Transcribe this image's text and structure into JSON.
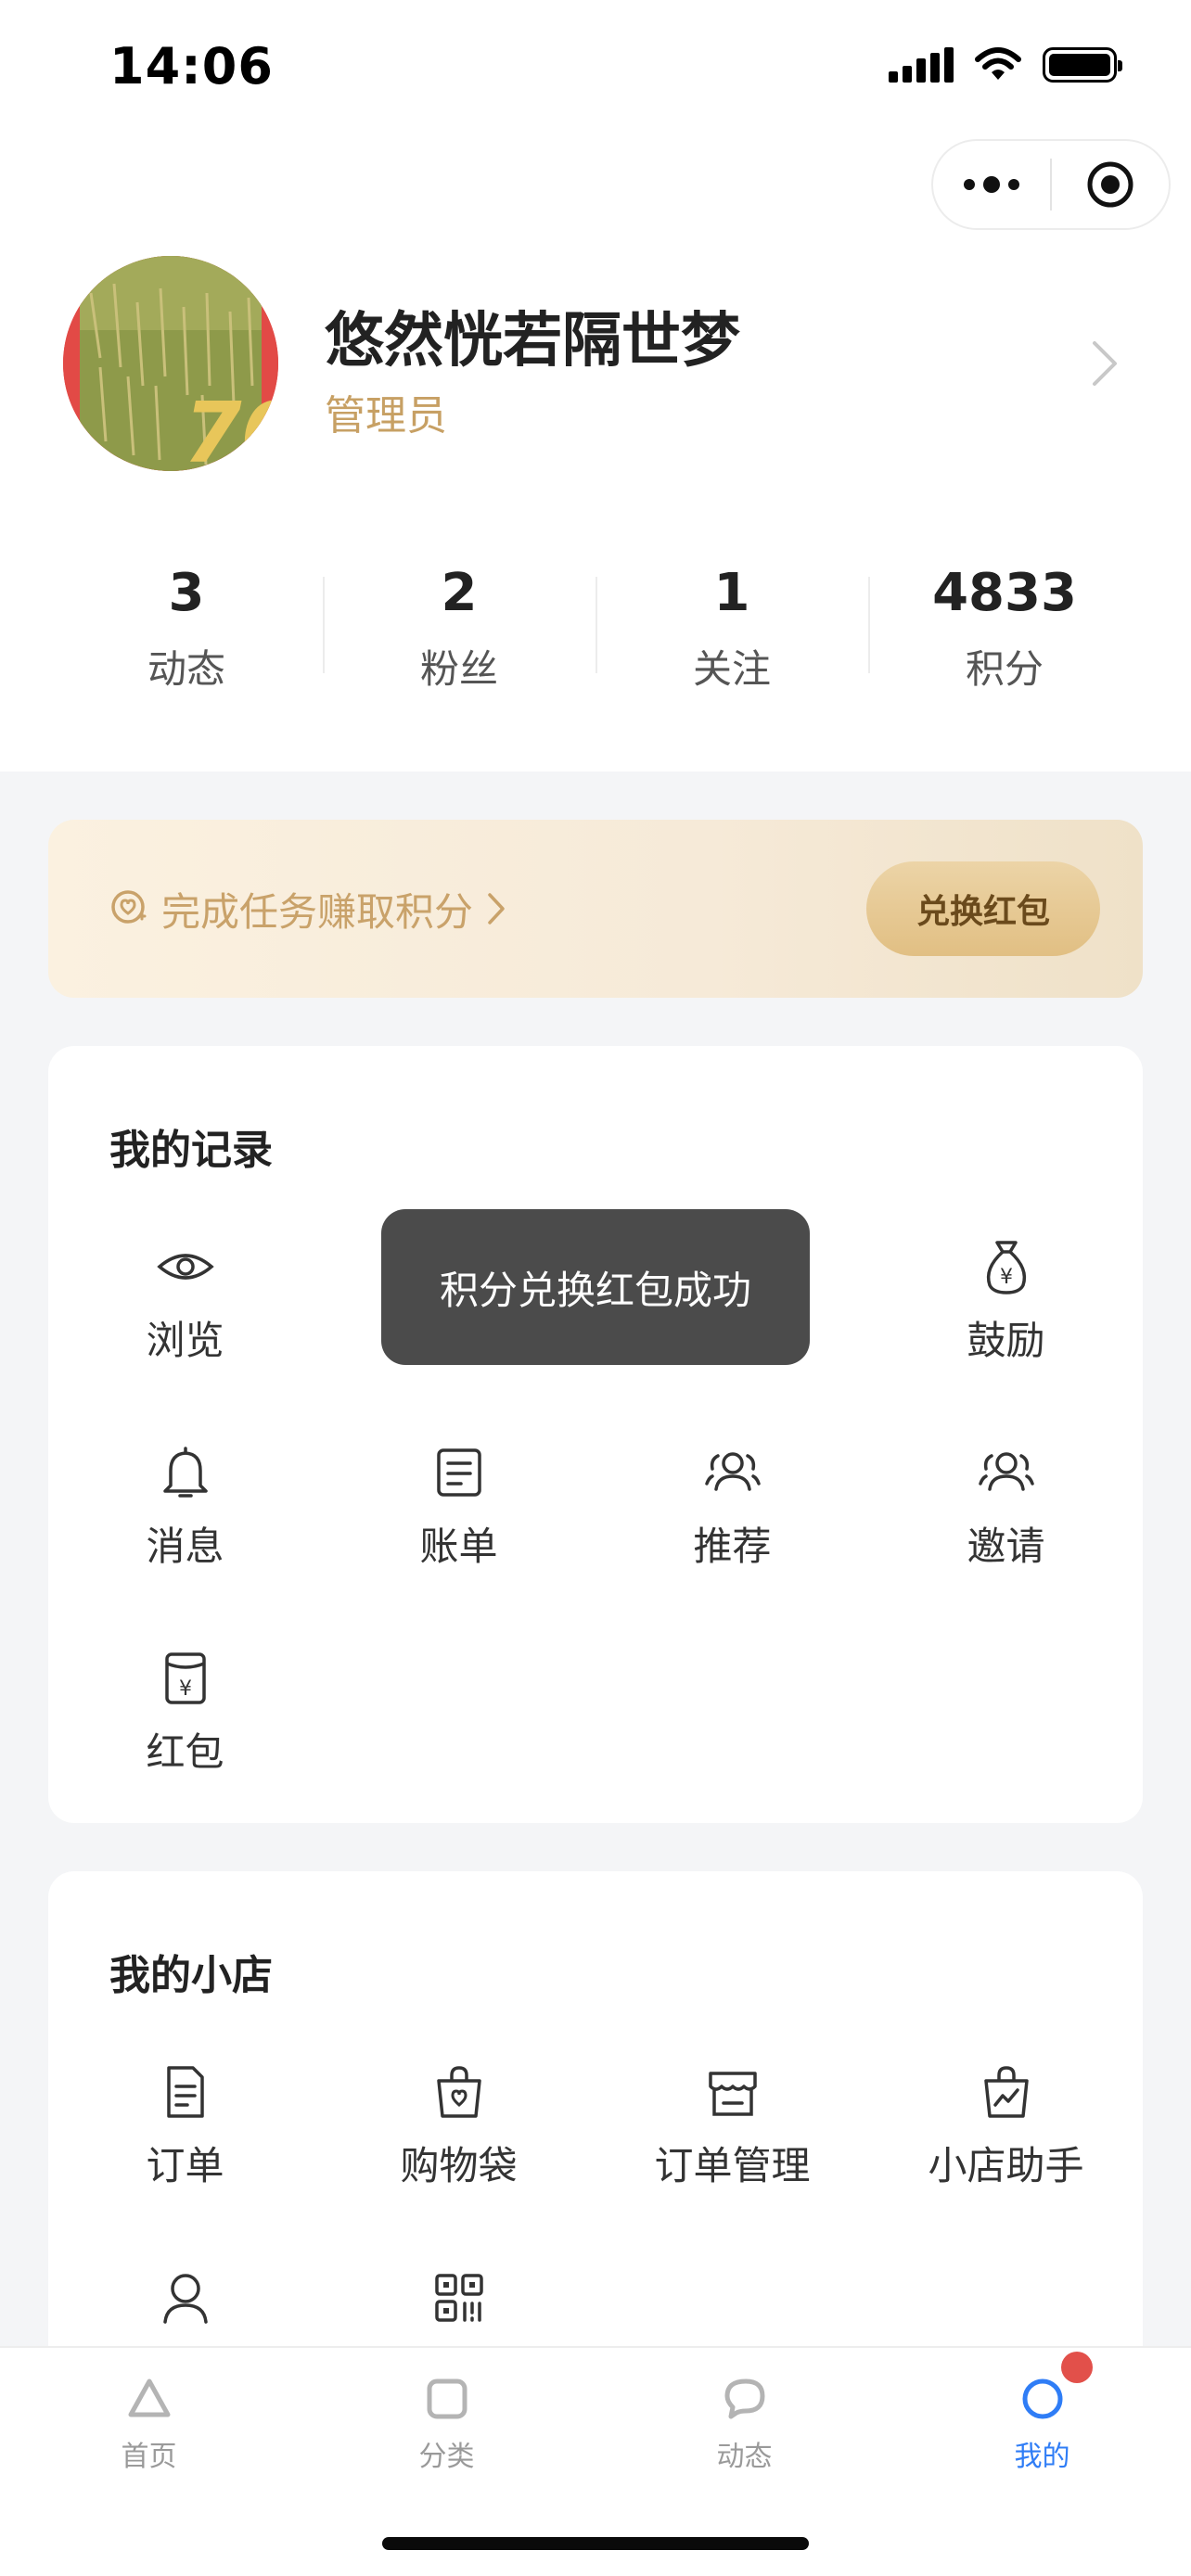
{
  "status_bar": {
    "time": "14:06"
  },
  "profile": {
    "name": "悠然恍若隔世梦",
    "role": "管理员"
  },
  "stats": [
    {
      "value": "3",
      "label": "动态"
    },
    {
      "value": "2",
      "label": "粉丝"
    },
    {
      "value": "1",
      "label": "关注"
    },
    {
      "value": "4833",
      "label": "积分"
    }
  ],
  "task_banner": {
    "text": "完成任务赚取积分",
    "button": "兑换红包"
  },
  "records": {
    "title": "我的记录",
    "items": [
      "浏览",
      "",
      "",
      "鼓励",
      "消息",
      "账单",
      "推荐",
      "邀请",
      "红包"
    ]
  },
  "toast": {
    "message": "积分兑换红包成功"
  },
  "shop": {
    "title": "我的小店",
    "items": [
      "订单",
      "购物袋",
      "订单管理",
      "小店助手"
    ]
  },
  "tabbar": {
    "items": [
      "首页",
      "分类",
      "动态",
      "我的"
    ],
    "active": "我的"
  },
  "colors": {
    "accent_gold": "#c9a26a",
    "tab_active": "#2f7df6",
    "badge_red": "#e2504a",
    "toast_bg": "#4b4b4b"
  }
}
